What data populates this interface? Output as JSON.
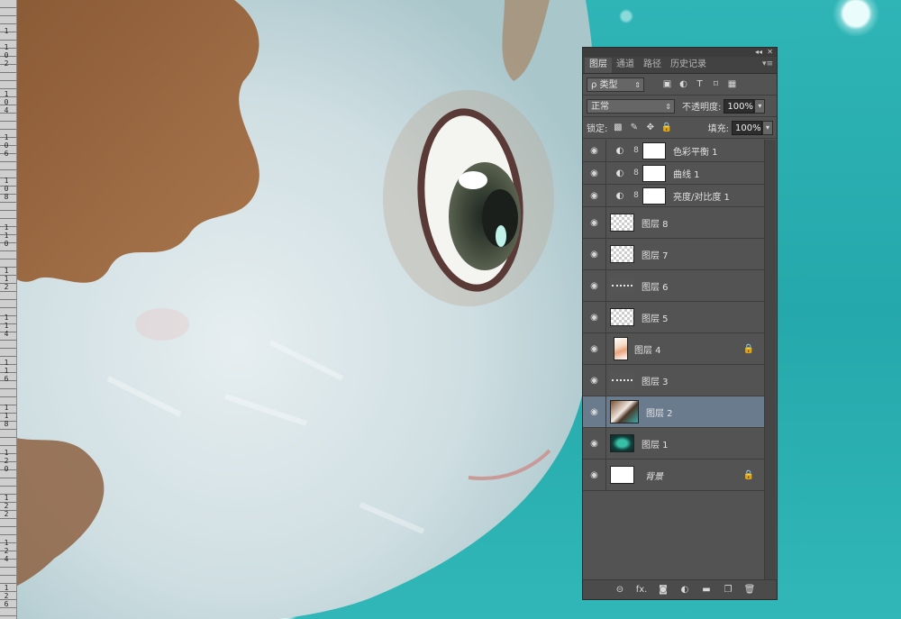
{
  "ruler": {
    "labels": [
      "1",
      "102",
      "104",
      "106",
      "108",
      "110",
      "112",
      "114",
      "116",
      "118",
      "120",
      "122",
      "124",
      "126"
    ]
  },
  "panel": {
    "controls": {
      "collapse": "◂◂",
      "close": "✕"
    },
    "tabs": [
      {
        "label": "图层",
        "active": true
      },
      {
        "label": "通道",
        "active": false
      },
      {
        "label": "路径",
        "active": false
      },
      {
        "label": "历史记录",
        "active": false
      }
    ],
    "tab_menu": "▾≡",
    "filter": {
      "label": "ρ 类型",
      "arrow": "⇕"
    },
    "filter_icons": [
      "▣",
      "◐",
      "T",
      "⌑",
      "▦"
    ],
    "blend_mode": "正常",
    "opacity": {
      "label": "不透明度:",
      "value": "100%"
    },
    "lock": {
      "label": "锁定:",
      "icons": [
        "▩",
        "✎",
        "✥",
        "🔒"
      ]
    },
    "fill": {
      "label": "填充:",
      "value": "100%"
    },
    "layers": [
      {
        "name": "色彩平衡 1",
        "kind": "adj",
        "icon": "◐"
      },
      {
        "name": "曲线 1",
        "kind": "adj",
        "icon": "◐"
      },
      {
        "name": "亮度/对比度 1",
        "kind": "adj",
        "icon": "◐"
      },
      {
        "name": "图层 8",
        "kind": "trans"
      },
      {
        "name": "图层 7",
        "kind": "trans"
      },
      {
        "name": "图层 6",
        "kind": "line"
      },
      {
        "name": "图层 5",
        "kind": "trans"
      },
      {
        "name": "图层 4",
        "kind": "sketch",
        "locked": true
      },
      {
        "name": "图层 3",
        "kind": "line"
      },
      {
        "name": "图层 2",
        "kind": "art",
        "selected": true
      },
      {
        "name": "图层 1",
        "kind": "dark"
      },
      {
        "name": "背景",
        "kind": "white",
        "locked": true,
        "italic": true
      }
    ],
    "bottom_icons": [
      "⊝",
      "fx.",
      "◙",
      "◐",
      "▬",
      "❐",
      "🗑"
    ]
  },
  "colors": {
    "panel_bg": "#535353",
    "selected": "#6b7b8e",
    "canvas_teal": "#2fb3b5"
  }
}
